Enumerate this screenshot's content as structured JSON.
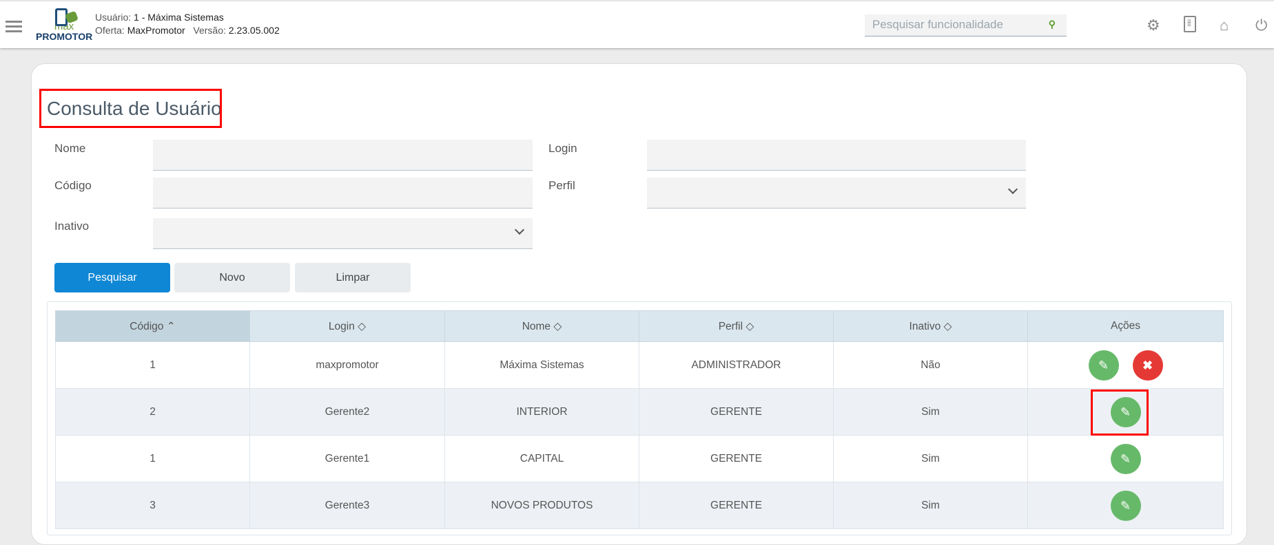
{
  "header": {
    "user_label": "Usuário:",
    "user_value": "1 - Máxima Sistemas",
    "offer_label": "Oferta:",
    "offer_value": "MaxPromotor",
    "version_label": "Versão:",
    "version_value": "2.23.05.002",
    "logo_top": "max",
    "logo_bottom": "PROMOTOR",
    "search_placeholder": "Pesquisar funcionalidade"
  },
  "page": {
    "title": "Consulta de Usuário"
  },
  "form": {
    "nome": "Nome",
    "login": "Login",
    "codigo": "Código",
    "perfil": "Perfil",
    "inativo": "Inativo"
  },
  "buttons": {
    "search": "Pesquisar",
    "new": "Novo",
    "clear": "Limpar"
  },
  "table": {
    "headers": [
      "Código",
      "Login",
      "Nome",
      "Perfil",
      "Inativo",
      "Ações"
    ],
    "rows": [
      [
        "1",
        "maxpromotor",
        "Máxima Sistemas",
        "ADMINISTRADOR",
        "Não"
      ],
      [
        "2",
        "Gerente2",
        "INTERIOR",
        "GERENTE",
        "Sim"
      ],
      [
        "1",
        "Gerente1",
        "CAPITAL",
        "GERENTE",
        "Sim"
      ],
      [
        "3",
        "Gerente3",
        "NOVOS PRODUTOS",
        "GERENTE",
        "Sim"
      ]
    ]
  },
  "colors": {
    "primary": "#0f87d4",
    "edit": "#67b96a",
    "delete": "#e53935",
    "highlight": "#ff0000"
  }
}
